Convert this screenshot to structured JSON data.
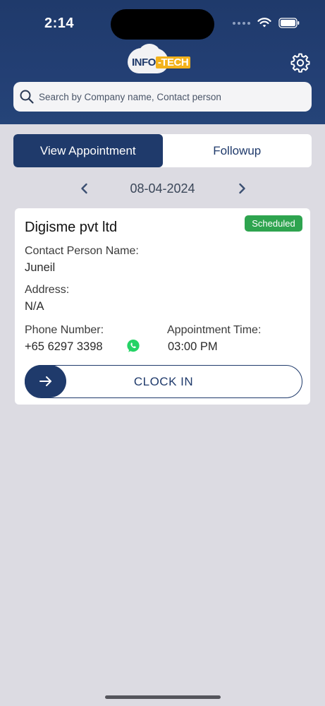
{
  "status_bar": {
    "time": "2:14"
  },
  "header": {
    "logo_text_1": "INFO",
    "logo_text_2": "-TECH",
    "settings_icon": "gear-icon"
  },
  "search": {
    "placeholder": "Search by Company name, Contact person",
    "value": ""
  },
  "tabs": [
    {
      "label": "View Appointment",
      "active": true
    },
    {
      "label": "Followup",
      "active": false
    }
  ],
  "date_nav": {
    "date": "08-04-2024"
  },
  "appointment": {
    "company": "Digisme pvt ltd",
    "status": "Scheduled",
    "contact_label": "Contact Person Name:",
    "contact_value": "Juneil",
    "address_label": "Address:",
    "address_value": "N/A",
    "phone_label": "Phone Number:",
    "phone_value": "+65 6297 3398",
    "time_label": "Appointment Time:",
    "time_value": "03:00 PM",
    "clock_in_label": "CLOCK IN"
  },
  "colors": {
    "primary": "#1f3a6b",
    "status_green": "#2ea44f",
    "whatsapp": "#25d366",
    "logo_accent": "#f3b21b"
  }
}
